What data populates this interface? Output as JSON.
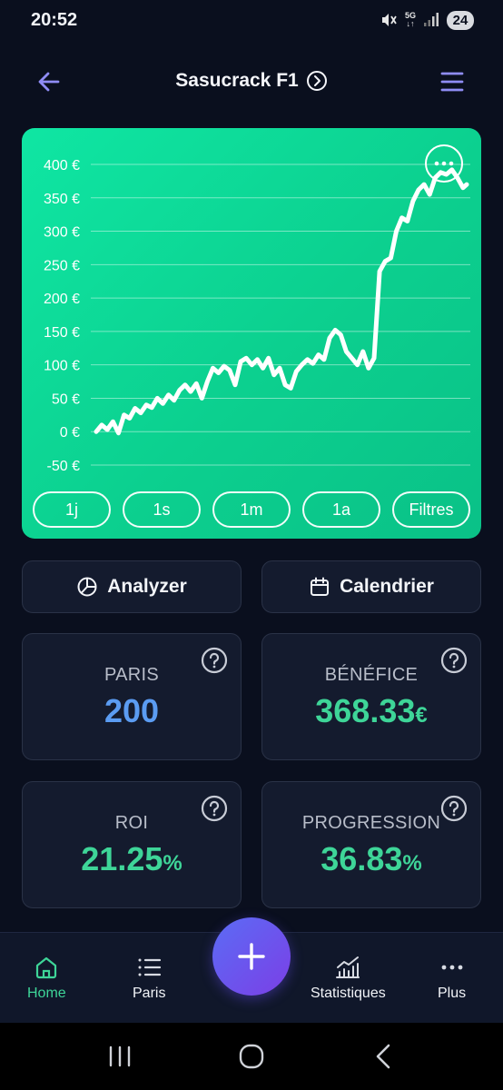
{
  "status_bar": {
    "time": "20:52",
    "network": "5G",
    "battery": "24",
    "icons": [
      "mute-icon",
      "network-arrows-icon",
      "signal-icon"
    ]
  },
  "header": {
    "title": "Sasucrack F1",
    "icons": [
      "back-arrow-icon",
      "chevron-right-circle-icon",
      "hamburger-menu-icon"
    ]
  },
  "colors": {
    "background": "#0a0f1e",
    "card": "#141b2e",
    "chart_green": "#0fe6a3",
    "accent_purple": "#7b7ff0",
    "value_blue": "#5b9cf2",
    "value_green": "#3ed598",
    "fab_gradient": [
      "#5b6cf5",
      "#7b3fe6"
    ]
  },
  "chart_data": {
    "type": "line",
    "y_tick_labels": [
      "400 €",
      "350 €",
      "300 €",
      "250 €",
      "200 €",
      "150 €",
      "100 €",
      "50 €",
      "0 €",
      "-50 €"
    ],
    "y_ticks": [
      400,
      350,
      300,
      250,
      200,
      150,
      100,
      50,
      0,
      -50
    ],
    "ylim": [
      -50,
      400
    ],
    "grid": true,
    "line_color": "#ffffff",
    "series": [
      {
        "x": [
          0,
          3,
          6,
          9,
          12,
          15,
          18,
          21,
          24,
          27,
          30,
          33,
          36,
          39,
          42,
          45,
          48,
          51,
          54,
          57,
          60,
          63,
          66,
          69,
          72,
          75,
          78,
          81,
          84,
          87,
          90,
          93,
          96,
          99,
          102,
          105,
          108,
          111,
          114,
          117,
          120,
          123,
          126,
          129,
          132,
          135,
          138,
          141,
          144,
          147,
          150,
          153,
          156,
          159,
          162,
          165,
          168,
          171,
          174,
          177,
          180,
          183,
          186,
          189,
          192,
          195,
          198,
          200
        ],
        "values": [
          0,
          10,
          3,
          15,
          -2,
          25,
          20,
          35,
          28,
          40,
          36,
          50,
          42,
          55,
          47,
          62,
          70,
          60,
          72,
          50,
          75,
          95,
          88,
          98,
          92,
          70,
          105,
          110,
          100,
          108,
          95,
          110,
          85,
          95,
          70,
          65,
          90,
          100,
          108,
          102,
          115,
          108,
          140,
          152,
          145,
          120,
          110,
          100,
          120,
          95,
          110,
          240,
          255,
          260,
          300,
          320,
          315,
          345,
          362,
          370,
          355,
          380,
          388,
          385,
          392,
          380,
          365,
          370
        ]
      }
    ],
    "x_range_buttons": [
      "1j",
      "1s",
      "1m",
      "1a",
      "Filtres"
    ]
  },
  "actions": {
    "analyzer_label": "Analyzer",
    "calendar_label": "Calendrier"
  },
  "stats": {
    "paris": {
      "label": "PARIS",
      "value": "200",
      "unit": ""
    },
    "benefice": {
      "label": "BÉNÉFICE",
      "value": "368.33",
      "unit": "€"
    },
    "roi": {
      "label": "ROI",
      "value": "21.25",
      "unit": "%"
    },
    "progression": {
      "label": "PROGRESSION",
      "value": "36.83",
      "unit": "%"
    }
  },
  "bottom_nav": {
    "items": [
      {
        "label": "Home",
        "icon": "home-icon",
        "active": true
      },
      {
        "label": "Paris",
        "icon": "list-icon",
        "active": false
      },
      {
        "label": "Statistiques",
        "icon": "stats-chart-icon",
        "active": false
      },
      {
        "label": "Plus",
        "icon": "more-horizontal-icon",
        "active": false
      }
    ],
    "fab_icon": "plus-icon"
  }
}
